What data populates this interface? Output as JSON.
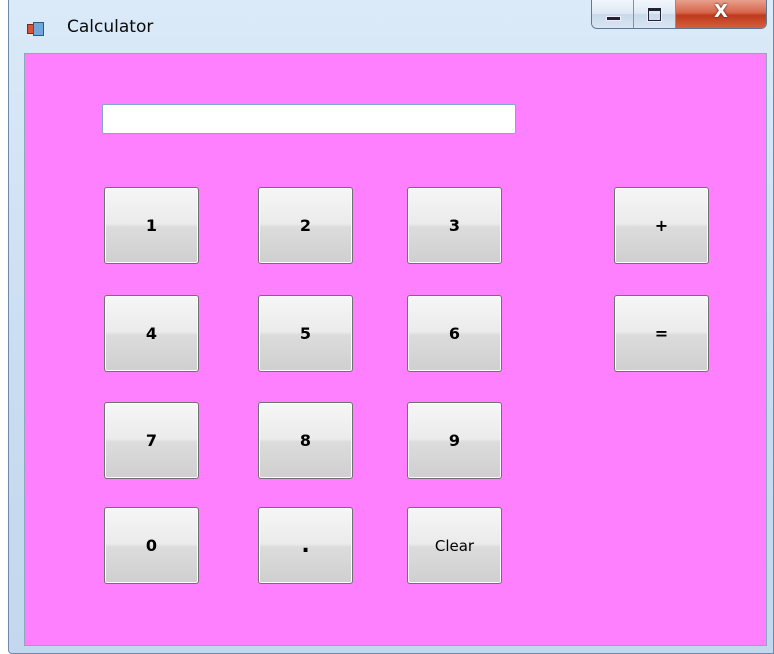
{
  "window": {
    "title": "Calculator",
    "caption_buttons": {
      "minimize": "minimize",
      "maximize": "maximize",
      "close": "close"
    }
  },
  "form": {
    "background_color": "#ff80ff",
    "display_value": "",
    "buttons": {
      "one": "1",
      "two": "2",
      "three": "3",
      "plus": "+",
      "four": "4",
      "five": "5",
      "six": "6",
      "equals": "=",
      "seven": "7",
      "eight": "8",
      "nine": "9",
      "zero": "0",
      "dot": ".",
      "clear": "Clear"
    }
  }
}
